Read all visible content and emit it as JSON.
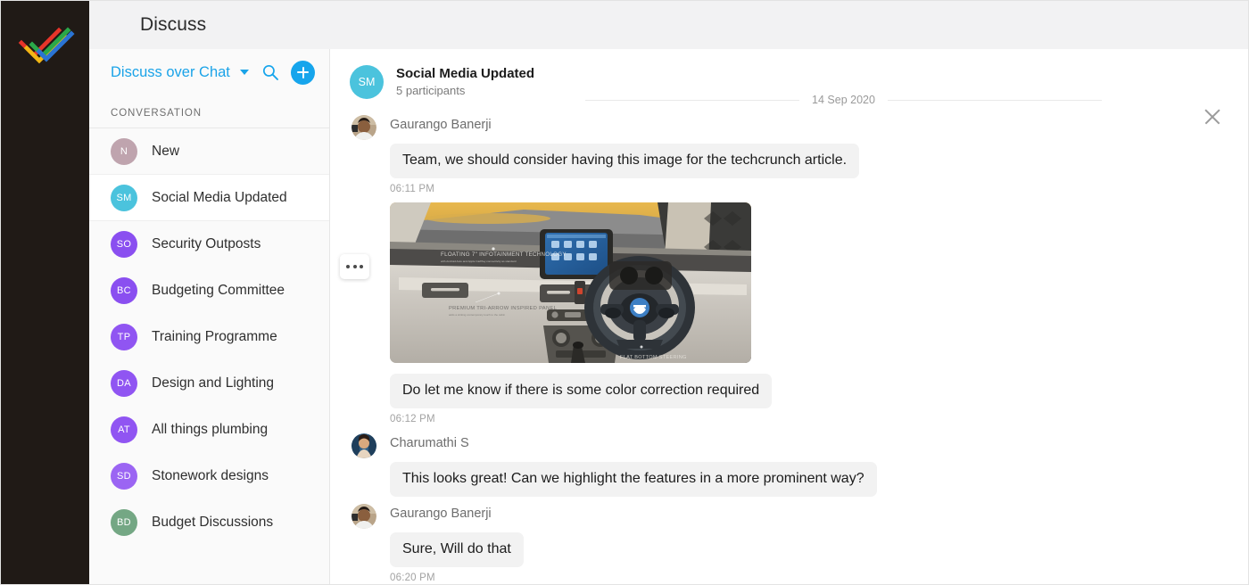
{
  "app": {
    "title": "Discuss",
    "logo_icon": "zoho-checkmark-logo",
    "rail_color": "#201a16",
    "accent_color": "#16a5ec"
  },
  "sidebar": {
    "header": {
      "title": "Discuss over Chat",
      "caret_icon": "chevron-down-icon",
      "search_icon": "search-icon",
      "add_icon": "plus-circle-icon"
    },
    "section_label": "CONVERSATION",
    "items": [
      {
        "initials": "N",
        "label": "New",
        "color": "#bfa4ae",
        "selected": false
      },
      {
        "initials": "SM",
        "label": "Social Media Updated",
        "color": "#4bc3dd",
        "selected": true
      },
      {
        "initials": "SO",
        "label": "Security Outposts",
        "color": "#8a4ff0",
        "selected": false
      },
      {
        "initials": "BC",
        "label": "Budgeting Committee",
        "color": "#8a4ff0",
        "selected": false
      },
      {
        "initials": "TP",
        "label": "Training Programme",
        "color": "#9055f2",
        "selected": false
      },
      {
        "initials": "DA",
        "label": "Design and Lighting",
        "color": "#9055f2",
        "selected": false
      },
      {
        "initials": "AT",
        "label": "All things plumbing",
        "color": "#9055f2",
        "selected": false
      },
      {
        "initials": "SD",
        "label": "Stonework designs",
        "color": "#9b65f3",
        "selected": false
      },
      {
        "initials": "BD",
        "label": "Budget Discussions",
        "color": "#74a784",
        "selected": false
      }
    ]
  },
  "chat": {
    "header": {
      "initials": "SM",
      "avatar_color": "#4bc3dd",
      "title": "Social Media Updated",
      "participants": "5 participants",
      "close_icon": "close-icon"
    },
    "date_divider": "14 Sep 2020",
    "messages": [
      {
        "author": "Gaurango Banerji",
        "text": "Team, we should consider having this image for the techcrunch article.",
        "time": "06:11 PM",
        "show_author": true,
        "attachment": null
      },
      {
        "author": "Gaurango Banerji",
        "text": "Do let me know if there is some color correction required",
        "time": "06:12 PM",
        "show_author": false,
        "attachment": {
          "type": "image",
          "description": "Car dashboard interior photo",
          "overlay_labels": [
            "FLOATING 7\" INFOTAINMENT TECHNOLOGY",
            "PREMIUM TRI-ARROW INSPIRED PANEL",
            "FLAT BOTTOM STEERING"
          ],
          "more_icon": "more-options-icon"
        }
      },
      {
        "author": "Charumathi S",
        "text": "This looks great! Can we highlight the features in a more prominent way?",
        "time": "",
        "show_author": true,
        "attachment": null
      },
      {
        "author": "Gaurango Banerji",
        "text": "Sure, Will do that",
        "time": "06:20 PM",
        "show_author": true,
        "attachment": null
      }
    ]
  }
}
